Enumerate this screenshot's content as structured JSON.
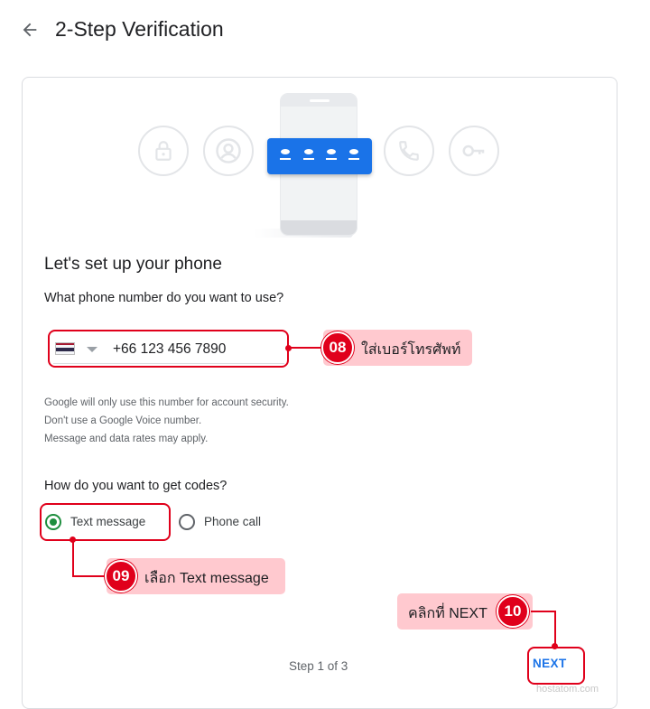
{
  "header": {
    "title": "2-Step Verification",
    "back_icon": "arrow-left-icon"
  },
  "illustration": {
    "icons": [
      "lock-icon",
      "person-icon",
      "phone-call-icon",
      "key-icon"
    ],
    "accent_color": "#1a73e8"
  },
  "setup": {
    "heading": "Let's set up your phone",
    "phone_question": "What phone number do you want to use?",
    "country_flag": "thailand-flag-icon",
    "phone_number": "+66 123 456 7890",
    "notes": [
      "Google will only use this number for account security.",
      "Don't use a Google Voice number.",
      "Message and data rates may apply."
    ],
    "codes_question": "How do you want to get codes?",
    "options": [
      {
        "label": "Text message",
        "selected": true
      },
      {
        "label": "Phone call",
        "selected": false
      }
    ]
  },
  "footer": {
    "step": "Step 1 of 3",
    "next_label": "NEXT"
  },
  "annotations": [
    {
      "num": "08",
      "text": "ใส่เบอร์โทรศัพท์"
    },
    {
      "num": "09",
      "text": "เลือก Text message"
    },
    {
      "num": "10",
      "text": "คลิกที่ NEXT"
    }
  ],
  "annotation_color": "#e0001b",
  "watermark": "hostatom.com"
}
